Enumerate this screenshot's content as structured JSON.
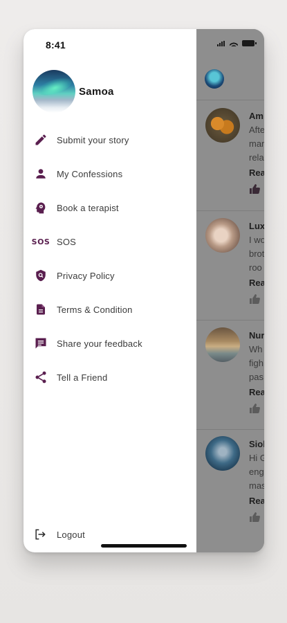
{
  "status_bar": {
    "time": "8:41"
  },
  "drawer": {
    "profile": {
      "name": "Samoa"
    },
    "menu": [
      {
        "label": "Submit your story",
        "icon": "pencil-icon"
      },
      {
        "label": "My Confessions",
        "icon": "person-icon"
      },
      {
        "label": "Book a terapist",
        "icon": "head-icon"
      },
      {
        "label": "SOS",
        "icon": "sos-icon",
        "icon_text": "SOS"
      },
      {
        "label": "Privacy Policy",
        "icon": "shield-icon"
      },
      {
        "label": "Terms & Condition",
        "icon": "document-icon"
      },
      {
        "label": "Share your feedback",
        "icon": "feedback-icon"
      },
      {
        "label": "Tell a Friend",
        "icon": "share-icon"
      }
    ],
    "logout": {
      "label": "Logout",
      "icon": "logout-icon"
    }
  },
  "feed": {
    "posts": [
      {
        "name": "Am",
        "lines": [
          "Afte",
          "mar",
          "rela"
        ],
        "read": "Rea"
      },
      {
        "name": "Lux",
        "lines": [
          "I wo",
          "brot",
          "roo"
        ],
        "read": "Rea"
      },
      {
        "name": "Nur",
        "lines": [
          "Wh",
          "figh",
          "pas"
        ],
        "read": "Rea"
      },
      {
        "name": "Siol",
        "lines": [
          "Hi G",
          "eng",
          "mas"
        ],
        "read": "Rea"
      }
    ]
  },
  "colors": {
    "accent": "#5a1f4f",
    "overlay": "#8e8e8e",
    "drawer_bg": "#ffffff"
  }
}
